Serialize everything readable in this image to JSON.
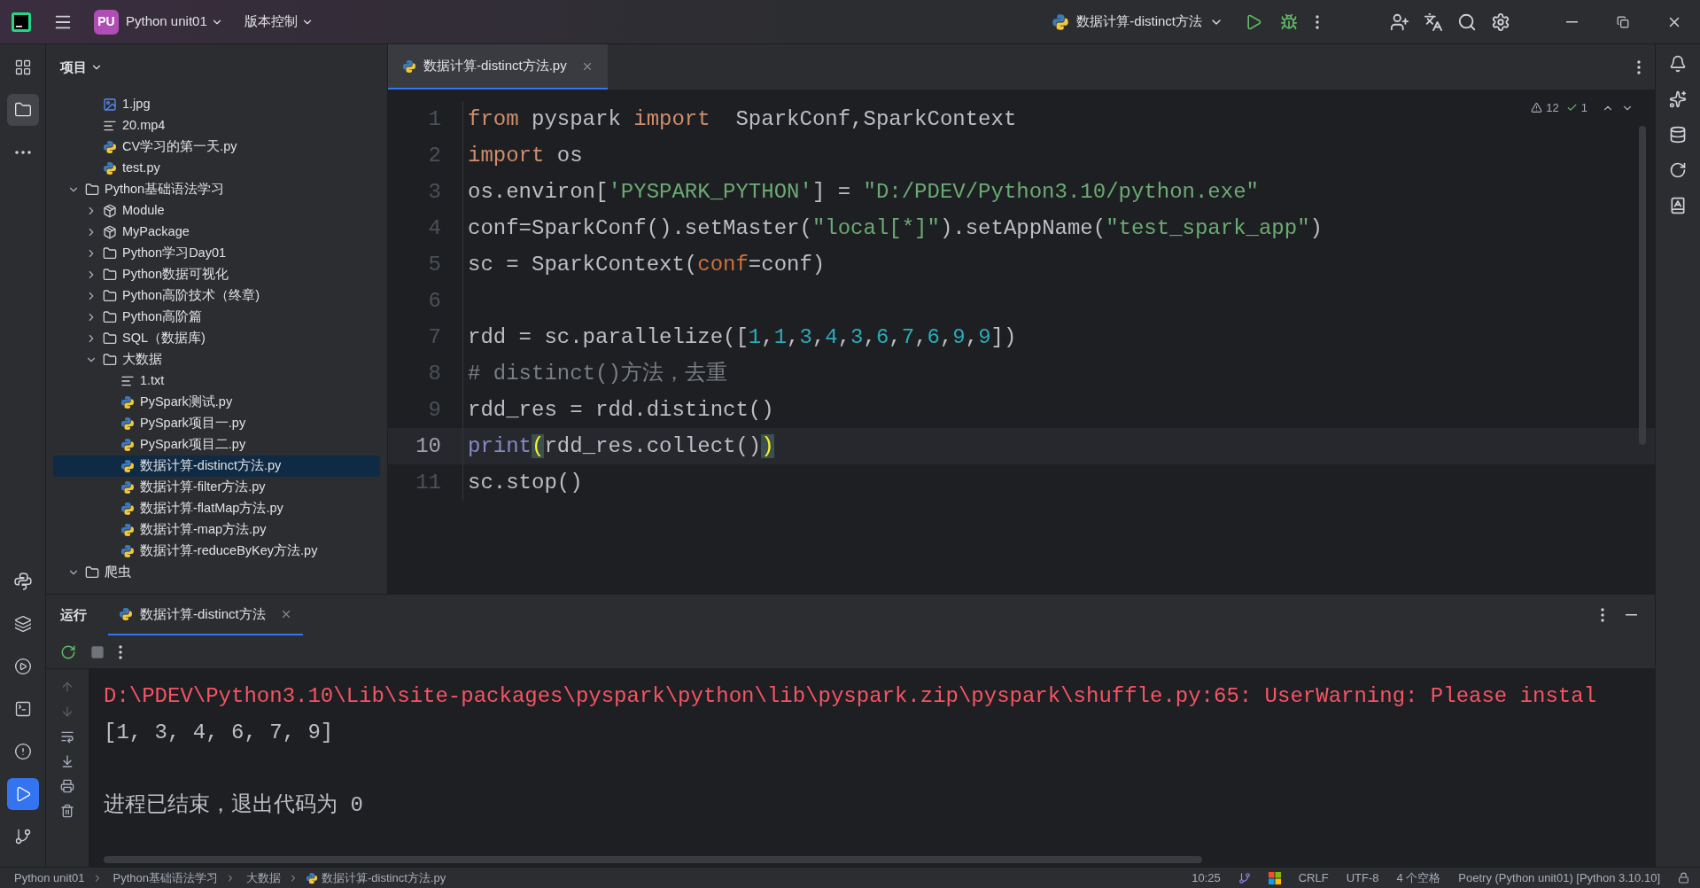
{
  "title_bar": {
    "project_badge": "PU",
    "project": "Python unit01",
    "vcs": "版本控制",
    "run_config": "数据计算-distinct方法"
  },
  "left_toolbar": {
    "top": [
      {
        "kind": "structure",
        "selected": false
      },
      {
        "kind": "project",
        "selected": true
      },
      {
        "kind": "more",
        "selected": false
      }
    ],
    "bottom": [
      {
        "kind": "python",
        "selected": false
      },
      {
        "kind": "layers",
        "selected": false
      },
      {
        "kind": "services",
        "selected": false
      },
      {
        "kind": "terminal",
        "selected": false
      },
      {
        "kind": "problems",
        "selected": false
      },
      {
        "kind": "run",
        "selected": true
      },
      {
        "kind": "git",
        "selected": false
      }
    ]
  },
  "project_panel": {
    "title": "项目",
    "tree": {
      "scrolled_children": [
        {
          "label": "1.jpg",
          "kind": "image",
          "selected": false
        },
        {
          "label": "20.mp4",
          "kind": "text",
          "selected": false
        },
        {
          "label": "CV学习的第一天.py",
          "kind": "python",
          "selected": false
        },
        {
          "label": "test.py",
          "kind": "python",
          "selected": false
        }
      ],
      "nodes": [
        {
          "label": "Python基础语法学习",
          "kind": "folder",
          "expanded": true,
          "selected": false,
          "children": [
            {
              "label": "Module",
              "kind": "package",
              "expanded": false,
              "selected": false
            },
            {
              "label": "MyPackage",
              "kind": "package",
              "expanded": false,
              "selected": false
            },
            {
              "label": "Python学习Day01",
              "kind": "folder",
              "expanded": false,
              "selected": false
            },
            {
              "label": "Python数据可视化",
              "kind": "folder",
              "expanded": false,
              "selected": false
            },
            {
              "label": "Python高阶技术（终章)",
              "kind": "folder",
              "expanded": false,
              "selected": false
            },
            {
              "label": "Python高阶篇",
              "kind": "folder",
              "expanded": false,
              "selected": false
            },
            {
              "label": "SQL（数据库)",
              "kind": "folder",
              "expanded": false,
              "selected": false
            },
            {
              "label": "大数据",
              "kind": "folder",
              "expanded": true,
              "selected": false,
              "children": [
                {
                  "label": "1.txt",
                  "kind": "text",
                  "selected": false
                },
                {
                  "label": "PySpark测试.py",
                  "kind": "python",
                  "selected": false
                },
                {
                  "label": "PySpark项目一.py",
                  "kind": "python",
                  "selected": false
                },
                {
                  "label": "PySpark项目二.py",
                  "kind": "python",
                  "selected": false
                },
                {
                  "label": "数据计算-distinct方法.py",
                  "kind": "python",
                  "selected": true
                },
                {
                  "label": "数据计算-filter方法.py",
                  "kind": "python",
                  "selected": false
                },
                {
                  "label": "数据计算-flatMap方法.py",
                  "kind": "python",
                  "selected": false
                },
                {
                  "label": "数据计算-map方法.py",
                  "kind": "python",
                  "selected": false
                },
                {
                  "label": "数据计算-reduceByKey方法.py",
                  "kind": "python",
                  "selected": false
                }
              ]
            }
          ]
        },
        {
          "label": "爬虫",
          "kind": "folder",
          "expanded": true,
          "selected": false
        }
      ]
    }
  },
  "editor": {
    "tabs": [
      {
        "label": "数据计算-distinct方法.py",
        "selected": true
      }
    ],
    "inspections": {
      "warnings": "12",
      "ok": "1"
    },
    "lines": [
      {
        "number": "1",
        "current": false,
        "tokens": [
          {
            "kind": "keyword",
            "text": "from"
          },
          {
            "kind": "plain",
            "text": " pyspark "
          },
          {
            "kind": "keyword",
            "text": "import"
          },
          {
            "kind": "plain",
            "text": "  SparkConf,SparkContext"
          }
        ]
      },
      {
        "number": "2",
        "current": false,
        "tokens": [
          {
            "kind": "keyword",
            "text": "import"
          },
          {
            "kind": "plain",
            "text": " os"
          }
        ]
      },
      {
        "number": "3",
        "current": false,
        "tokens": [
          {
            "kind": "plain",
            "text": "os.environ["
          },
          {
            "kind": "string",
            "text": "'PYSPARK_PYTHON'"
          },
          {
            "kind": "plain",
            "text": "] = "
          },
          {
            "kind": "string",
            "text": "\"D:/PDEV/Python3.10/python.exe\""
          }
        ]
      },
      {
        "number": "4",
        "current": false,
        "tokens": [
          {
            "kind": "plain",
            "text": "conf=SparkConf().setMaster("
          },
          {
            "kind": "string",
            "text": "\"local[*]\""
          },
          {
            "kind": "plain",
            "text": ").setAppName("
          },
          {
            "kind": "string",
            "text": "\"test_spark_app\""
          },
          {
            "kind": "plain",
            "text": ")"
          }
        ]
      },
      {
        "number": "5",
        "current": false,
        "tokens": [
          {
            "kind": "plain",
            "text": "sc = SparkContext("
          },
          {
            "kind": "param",
            "text": "conf"
          },
          {
            "kind": "plain",
            "text": "=conf)"
          }
        ]
      },
      {
        "number": "6",
        "current": false
      },
      {
        "number": "7",
        "current": false,
        "tokens": [
          {
            "kind": "plain",
            "text": "rdd = sc.parallelize(["
          },
          {
            "kind": "number",
            "text": "1"
          },
          {
            "kind": "plain",
            "text": ","
          },
          {
            "kind": "number",
            "text": "1"
          },
          {
            "kind": "plain",
            "text": ","
          },
          {
            "kind": "number",
            "text": "3"
          },
          {
            "kind": "plain",
            "text": ","
          },
          {
            "kind": "number",
            "text": "4"
          },
          {
            "kind": "plain",
            "text": ","
          },
          {
            "kind": "number",
            "text": "3"
          },
          {
            "kind": "plain",
            "text": ","
          },
          {
            "kind": "number",
            "text": "6"
          },
          {
            "kind": "plain",
            "text": ","
          },
          {
            "kind": "number",
            "text": "7"
          },
          {
            "kind": "plain",
            "text": ","
          },
          {
            "kind": "number",
            "text": "6"
          },
          {
            "kind": "plain",
            "text": ","
          },
          {
            "kind": "number",
            "text": "9"
          },
          {
            "kind": "plain",
            "text": ","
          },
          {
            "kind": "number",
            "text": "9"
          },
          {
            "kind": "plain",
            "text": "])"
          }
        ]
      },
      {
        "number": "8",
        "current": false,
        "tokens": [
          {
            "kind": "comment",
            "text": "# distinct()方法，去重"
          }
        ]
      },
      {
        "number": "9",
        "current": false,
        "tokens": [
          {
            "kind": "plain",
            "text": "rdd_res = rdd.distinct()"
          }
        ]
      },
      {
        "number": "10",
        "current": true,
        "tokens": [
          {
            "kind": "builtin",
            "text": "print"
          },
          {
            "kind": "bracket_match",
            "text": "("
          },
          {
            "kind": "plain",
            "text": "rdd_res.collect()"
          },
          {
            "kind": "bracket_match",
            "text": ")"
          }
        ]
      },
      {
        "number": "11",
        "current": false,
        "tokens": [
          {
            "kind": "plain",
            "text": "sc.stop()"
          }
        ]
      }
    ]
  },
  "run_panel": {
    "title": "运行",
    "tabs": [
      {
        "label": "数据计算-distinct方法",
        "selected": true
      }
    ],
    "output": [
      {
        "kind": "error",
        "text": "D:\\PDEV\\Python3.10\\Lib\\site-packages\\pyspark\\python\\lib\\pyspark.zip\\pyspark\\shuffle.py:65: UserWarning: Please instal"
      },
      {
        "kind": "stdout",
        "text": "[1, 3, 4, 6, 7, 9]"
      },
      {
        "kind": "system",
        "text": "进程已结束，退出代码为 0"
      }
    ]
  },
  "status_bar": {
    "breadcrumbs": [
      "Python unit01",
      "Python基础语法学习",
      "大数据",
      "数据计算-distinct方法.py"
    ],
    "position": "10:25",
    "line_separator": "CRLF",
    "encoding": "UTF-8",
    "indent": "4 个空格",
    "interpreter": "Poetry (Python unit01) [Python 3.10.10]"
  }
}
